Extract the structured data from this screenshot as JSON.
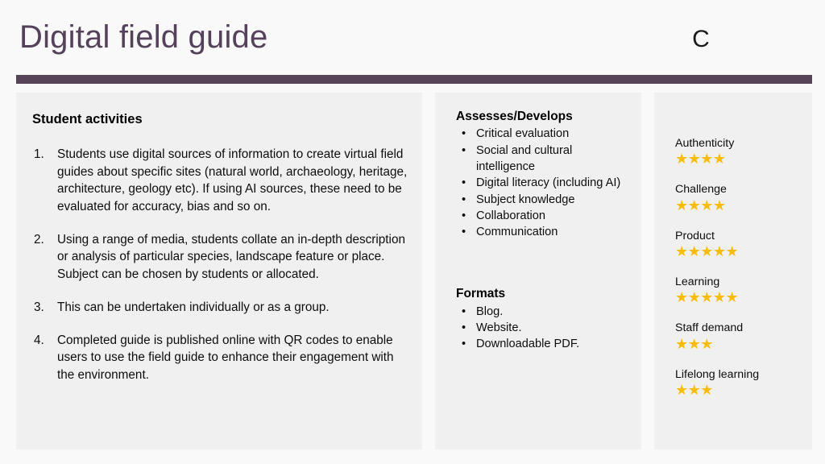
{
  "header": {
    "title": "Digital field guide",
    "brand_mark": "C",
    "rule_color": "#574459",
    "title_color": "#54425A"
  },
  "left_panel": {
    "heading": "Student activities",
    "activities": [
      {
        "number": "1.",
        "text": "Students use digital sources of information to create virtual field guides about specific sites (natural world, archaeology, heritage, architecture, geology etc). If using AI sources, these need to be evaluated for accuracy, bias and so on."
      },
      {
        "number": "2.",
        "text": "Using a range of media, students collate an in-depth description or analysis of particular species, landscape feature or place. Subject can be chosen by students or allocated."
      },
      {
        "number": "3.",
        "text": "This can be undertaken individually or as a group."
      },
      {
        "number": "4.",
        "text": "Completed guide is published online with QR codes to enable users to use the field guide to enhance their engagement with the environment."
      }
    ]
  },
  "middle_panel": {
    "assesses": {
      "heading": "Assesses/Develops",
      "items": [
        "Critical evaluation",
        "Social and cultural intelligence",
        "Digital literacy (including AI)",
        "Subject knowledge",
        "Collaboration",
        "Communication"
      ]
    },
    "formats": {
      "heading": "Formats",
      "items": [
        "Blog.",
        "Website.",
        "Downloadable PDF."
      ]
    },
    "bullet_glyph": "•"
  },
  "right_panel": {
    "star_color": "#FBBC05",
    "star_glyph": "★",
    "max_stars": 5,
    "ratings": [
      {
        "label": "Authenticity",
        "stars": 4,
        "stars_text": "★★★★"
      },
      {
        "label": "Challenge",
        "stars": 4,
        "stars_text": "★★★★"
      },
      {
        "label": "Product",
        "stars": 5,
        "stars_text": "★★★★★"
      },
      {
        "label": "Learning",
        "stars": 5,
        "stars_text": "★★★★★"
      },
      {
        "label": "Staff demand",
        "stars": 3,
        "stars_text": "★★★"
      },
      {
        "label": "Lifelong learning",
        "stars": 3,
        "stars_text": "★★★"
      }
    ]
  }
}
